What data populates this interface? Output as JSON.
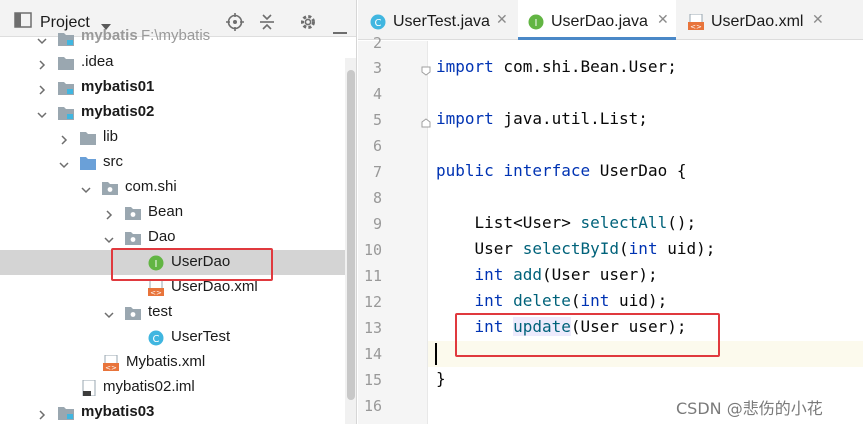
{
  "project_panel": {
    "title": "Project",
    "tree": [
      {
        "label": "mybatis",
        "suffix": "F:\\mybatis",
        "bold": true,
        "expanded": true
      },
      {
        "label": ".idea",
        "bold": false,
        "expanded": false
      },
      {
        "label": "mybatis01",
        "bold": true,
        "expanded": false
      },
      {
        "label": "mybatis02",
        "bold": true,
        "expanded": true
      },
      {
        "label": "lib",
        "bold": false,
        "expanded": false
      },
      {
        "label": "src",
        "bold": false,
        "expanded": true
      },
      {
        "label": "com.shi",
        "bold": false,
        "expanded": true
      },
      {
        "label": "Bean",
        "bold": false,
        "expanded": false
      },
      {
        "label": "Dao",
        "bold": false,
        "expanded": true
      },
      {
        "label": "UserDao",
        "bold": false,
        "selected": true
      },
      {
        "label": "UserDao.xml",
        "bold": false
      },
      {
        "label": "test",
        "bold": false,
        "expanded": true
      },
      {
        "label": "UserTest",
        "bold": false
      },
      {
        "label": "Mybatis.xml",
        "bold": false
      },
      {
        "label": "mybatis02.iml",
        "bold": false
      },
      {
        "label": "mybatis03",
        "bold": true,
        "expanded": false
      }
    ]
  },
  "tabs": [
    {
      "label": "UserTest.java",
      "icon": "class-icon",
      "active": false
    },
    {
      "label": "UserDao.java",
      "icon": "interface-icon",
      "active": true
    },
    {
      "label": "UserDao.xml",
      "icon": "xml-icon",
      "active": false
    }
  ],
  "editor": {
    "line_numbers": [
      "2",
      "3",
      "4",
      "5",
      "6",
      "7",
      "8",
      "9",
      "10",
      "11",
      "12",
      "13",
      "14",
      "15",
      "16"
    ],
    "lines": {
      "l3_kw": "import",
      "l3_rest": " com.shi.Bean.User;",
      "l5_kw": "import",
      "l5_rest": " java.util.List;",
      "l7_kw1": "public",
      "l7_kw2": "interface",
      "l7_rest": " UserDao {",
      "l9_a": "    List<User> ",
      "l9_m": "selectAll",
      "l9_b": "();",
      "l10_a": "    User ",
      "l10_m": "selectById",
      "l10_b": "(",
      "l10_kw": "int",
      "l10_c": " uid);",
      "l11_kw": "int",
      "l11_m": "add",
      "l11_b": "(User user);",
      "l12_kw": "int",
      "l12_m": "delete",
      "l12_b": "(",
      "l12_kw2": "int",
      "l12_c": " uid);",
      "l13_kw": "int",
      "l13_m": "update",
      "l13_b": "(User user);",
      "l15": "}"
    }
  },
  "watermark": "CSDN @悲伤的小花",
  "colors": {
    "keyword": "#0033b3",
    "method": "#00627a",
    "highlight_box": "#e0393e",
    "selection": "#d4d4d4",
    "active_tab_underline": "#4a88c7"
  }
}
